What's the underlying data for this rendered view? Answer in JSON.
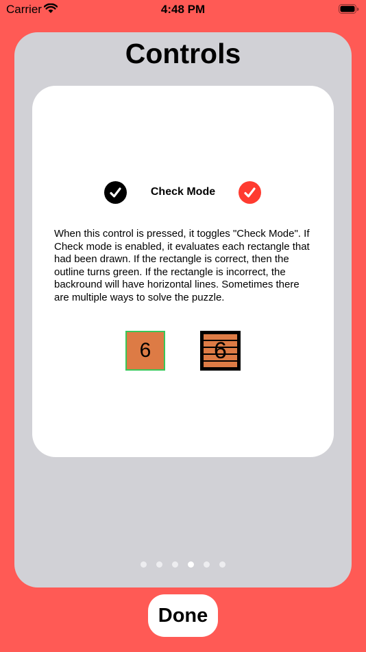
{
  "status_bar": {
    "carrier": "Carrier",
    "time": "4:48 PM",
    "wifi_icon": "wifi-icon",
    "battery_icon": "battery-icon"
  },
  "screen": {
    "title": "Controls"
  },
  "card": {
    "mode_label": "Check Mode",
    "left_icon": "checkmark-circle-black-icon",
    "right_icon": "checkmark-circle-red-icon",
    "description": "When this control is  pressed, it toggles \"Check Mode\". If Check mode is enabled, it evaluates each rectangle that had been drawn. If the rectangle is correct, then the  outline turns green. If the rectangle is incorrect, the backround will have horizontal lines. Sometimes there are multiple ways to solve the puzzle.",
    "examples": {
      "correct_tile_number": "6",
      "incorrect_tile_number": "6"
    }
  },
  "pagination": {
    "total_pages": 6,
    "current_page": 4
  },
  "done_button": {
    "label": "Done"
  },
  "colors": {
    "background": "#ff5a55",
    "panel": "#d1d1d6",
    "card": "#ffffff",
    "check_red": "#ff3b30",
    "tile_fill": "#dd7b45",
    "tile_correct_outline": "#38c759"
  }
}
